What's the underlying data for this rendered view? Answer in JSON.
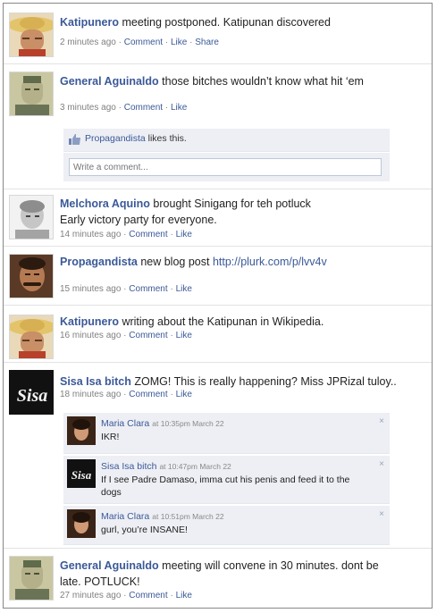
{
  "colors": {
    "link": "#3b5998",
    "meta": "#808080",
    "panel": "#edeff4"
  },
  "posts": [
    {
      "author": "Katipunero",
      "text": "meeting postponed. Katipunan discovered",
      "time": "2 minutes ago",
      "actions": [
        "Comment",
        "Like",
        "Share"
      ]
    },
    {
      "author": "General Aguinaldo",
      "text": "those bitches wouldn’t know what hit ‘em",
      "time": "3 minutes ago",
      "actions": [
        "Comment",
        "Like"
      ],
      "likes": {
        "who": "Propagandista",
        "suffix": "likes this."
      },
      "comment_placeholder": "Write a comment..."
    },
    {
      "author": "Melchora Aquino",
      "text": "brought Sinigang for teh potluck",
      "text2": "Early victory party for everyone.",
      "time": "14 minutes ago",
      "actions": [
        "Comment",
        "Like"
      ]
    },
    {
      "author": "Propagandista",
      "text": "new blog post",
      "link": "http://plurk.com/p/lvv4v",
      "time": "15 minutes ago",
      "actions": [
        "Comment",
        "Like"
      ]
    },
    {
      "author": "Katipunero",
      "text": "writing about the Katipunan in Wikipedia.",
      "time": "16 minutes ago",
      "actions": [
        "Comment",
        "Like"
      ]
    },
    {
      "author": "Sisa Isa bitch",
      "text": "ZOMG! This is really happening? Miss JPRizal tuloy..",
      "time": "18 minutes ago",
      "actions": [
        "Comment",
        "Like"
      ],
      "avatar_text": "Sisa",
      "replies": [
        {
          "name": "Maria Clara",
          "time": "at 10:35pm March 22",
          "text": "IKR!"
        },
        {
          "name": "Sisa Isa bitch",
          "time": "at 10:47pm March 22",
          "text": "If I see Padre Damaso, imma cut his penis and feed it to the dogs",
          "avatar_text": "Sisa"
        },
        {
          "name": "Maria Clara",
          "time": "at 10:51pm March 22",
          "text": "gurl, you’re INSANE!"
        }
      ]
    },
    {
      "author": "General Aguinaldo",
      "text": "meeting will convene in 30 minutes. dont be",
      "text2": "late. POTLUCK!",
      "time": "27 minutes ago",
      "actions": [
        "Comment",
        "Like"
      ]
    }
  ],
  "sep": "·",
  "close_glyph": "×"
}
